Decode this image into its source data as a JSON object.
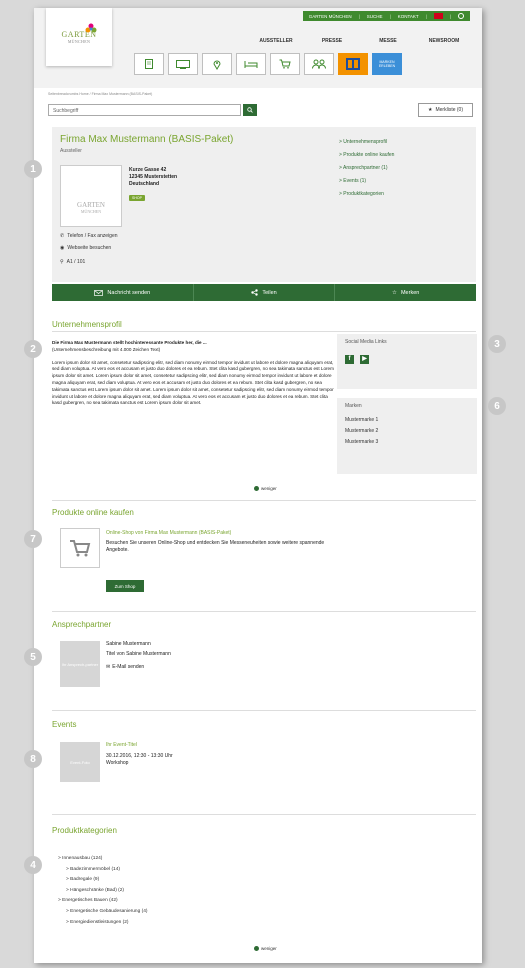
{
  "header": {
    "topbar": [
      "GARTEN MÜNCHEN",
      "SUCHE",
      "KONTAKT"
    ],
    "logo": {
      "line1": "GARTEN",
      "line2": "MÜNCHEN"
    },
    "nav": [
      "AUSSTELLER",
      "PRESSE",
      "MESSE",
      "NEWSROOM"
    ],
    "icon_buttons": [
      "document-icon",
      "screen-icon",
      "location-pin-icon",
      "bed-icon",
      "cart-icon",
      "people-icon",
      "partner-logo-orange",
      "partner-logo-blue"
    ],
    "blue_button_text": "MARKEN ERLEBEN"
  },
  "breadcrumb": "Seitenbreadcrumbs   Home  /  Firma Max Mustermann (BASIS-Paket)",
  "search": {
    "placeholder": "Suchbegriff"
  },
  "merkliste": "Merkliste (0)",
  "profile": {
    "title": "Firma Max Mustermann (BASIS-Paket)",
    "subtitle": "Aussteller",
    "address": [
      "Kurze Gasse 42",
      "12345 Musterstetten",
      "Deutschland"
    ],
    "badge": "SHOP",
    "phone": "Telefon / Fax anzeigen",
    "website": "Webseite besuchen",
    "stand": "A1 / 101",
    "anchors": [
      "> Unternehmensprofil",
      "> Produkte online kaufen",
      "> Ansprechpartner (1)",
      "> Events (1)",
      "> Produktkategorien"
    ]
  },
  "actions": {
    "message": "Nachricht senden",
    "share": "Teilen",
    "bookmark": "Merken"
  },
  "company_profile": {
    "title": "Unternehmensprofil",
    "intro": "Die Firma Max Mustermann stellt hochinteressante Produkte her, die ...",
    "intro_note": "(Unternehmensbeschreibung mit 4.000 Zeichen Text)",
    "text": "Lorem ipsum dolor sit amet, consetetur sadipscing elitr, sed diam nonumy eirmod tempor invidunt ut labore et dolore magna aliquyam erat, sed diam voluptua. At vero eos et accusam et justo duo dolores et ea rebum. Stet clita kasd gubergren, no sea takimata sanctus est Lorem ipsum dolor sit amet. Lorem ipsum dolor sit amet, consetetur sadipscing elitr, sed diam nonumy eirmod tempor invidunt ut labore et dolore magna aliquyam erat, sed diam voluptua. At vero eos et accusam et justo duo dolores et ea rebum. Stet clita kasd gubergren, no sea takimata sanctus est Lorem ipsum dolor sit amet. Lorem ipsum dolor sit amet, consetetur sadipscing elitr, sed diam nonumy eirmod tempor invidunt ut labore et dolore magna aliquyam erat, sed diam voluptua. At vero eos et accusam et justo duo dolores et ea rebum. Stet clita kasd gubergren, no sea takimata sanctus est Lorem ipsum dolor sit amet.",
    "less": "weniger"
  },
  "social": {
    "title": "Social Media Links"
  },
  "brands": {
    "title": "Marken",
    "items": [
      "Mustermarke 1",
      "Mustermarke 2",
      "Mustermarke 3"
    ]
  },
  "shop": {
    "title": "Produkte online kaufen",
    "link": "Online-Shop von Firma Max Mustermann (BASIS-Paket)",
    "desc": "Besuchen Sie unseren Online-Shop und entdecken Sie Messeneuheiten sowie weitere spannende Angebote.",
    "button": "Zum Shop"
  },
  "contact": {
    "title": "Ansprechpartner",
    "placeholder": "Ihr Ansprech-partner",
    "name": "Sabine Mustermann",
    "role": "Titel von Sabine Mustermann",
    "email": "E-Mail senden"
  },
  "events": {
    "title": "Events",
    "placeholder": "Event-Foto",
    "name": "Ihr Event-Titel",
    "time": "30.12.2016, 12:30 - 13:30 Uhr",
    "type": "Workshop"
  },
  "categories": {
    "title": "Produktkategorien",
    "items": [
      {
        "label": "> Innenausbau (124)",
        "level": 0
      },
      {
        "label": "> Badezimmermöbel (14)",
        "level": 1
      },
      {
        "label": "> Badregale (9)",
        "level": 1
      },
      {
        "label": "> Hängeschränke (Bad) (2)",
        "level": 1
      },
      {
        "label": "> Energetisches Bauen (42)",
        "level": 0
      },
      {
        "label": "> Energetische Gebäudesanierung (4)",
        "level": 1
      },
      {
        "label": "> Energiedienstleistungen (2)",
        "level": 1
      }
    ],
    "less": "weniger"
  },
  "markers": [
    "1",
    "2",
    "3",
    "6",
    "7",
    "5",
    "8",
    "4"
  ],
  "colors": {
    "green_dark": "#2e6b34",
    "green_light": "#7aa530",
    "topbar": "#3f8a2e",
    "orange": "#f39200",
    "blue": "#3b8fd8"
  }
}
